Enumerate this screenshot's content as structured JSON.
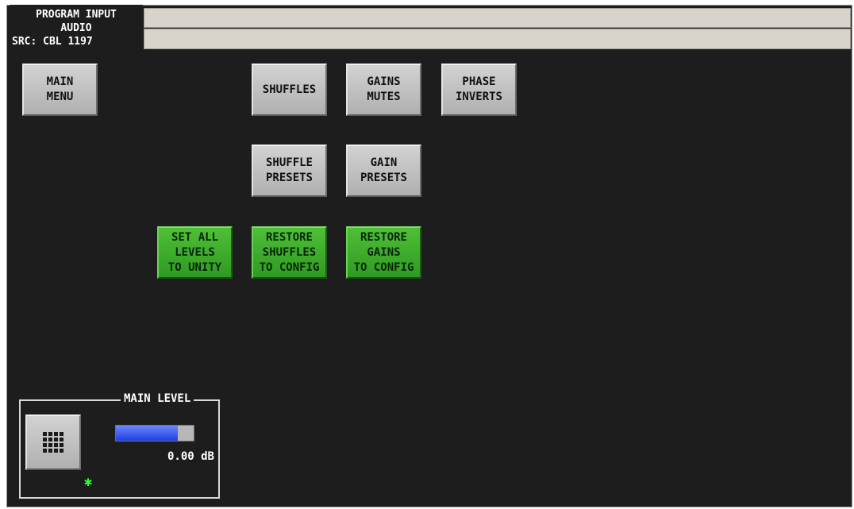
{
  "header": {
    "title_line1": "PROGRAM INPUT",
    "title_line2": "AUDIO",
    "source": "SRC: CBL 1197"
  },
  "buttons": {
    "main_menu": "MAIN\nMENU",
    "shuffles": "SHUFFLES",
    "gains_mutes": "GAINS\nMUTES",
    "phase_inverts": "PHASE\nINVERTS",
    "shuffle_presets": "SHUFFLE\nPRESETS",
    "gain_presets": "GAIN\nPRESETS",
    "set_all_levels": "SET ALL\nLEVELS\nTO UNITY",
    "restore_shuffles": "RESTORE\nSHUFFLES\nTO CONFIG",
    "restore_gains": "RESTORE\nGAINS\nTO CONFIG"
  },
  "main_level": {
    "label": "MAIN LEVEL",
    "value": "0.00 dB",
    "slider_fraction": 0.8,
    "keypad_icon": "keypad-grid-icon",
    "status_icon": "green-asterisk-icon"
  },
  "colors": {
    "background": "#1d1d1d",
    "gray_button": "#c0c0c0",
    "green_button": "#3fad2d",
    "slider_fill": "#3a5cf2",
    "status_indicator": "#2cff2c"
  }
}
